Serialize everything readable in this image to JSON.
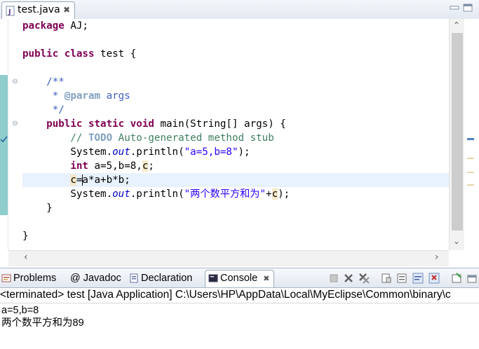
{
  "editor": {
    "tab": {
      "filename": "test.java",
      "close_glyph": "✖"
    },
    "code_lines": [
      "package AJ;",
      "",
      "public class test {",
      "",
      "    /**",
      "     * @param args",
      "     */",
      "    public static void main(String[] args) {",
      "        // TODO Auto-generated method stub",
      "        System.out.println(\"a=5,b=8\");",
      "        int a=5,b=8,c;",
      "        c=a*a+b*b;",
      "        System.out.println(\"两个数平方和为\"+c);",
      "    }",
      "",
      "}"
    ],
    "current_line": 12,
    "caret_after": "c=a*a+b*b;"
  },
  "console_view": {
    "tabs": [
      {
        "label": "Problems",
        "icon": "problems-icon"
      },
      {
        "label": "@ Javadoc",
        "icon": "javadoc-icon"
      },
      {
        "label": "Declaration",
        "icon": "declaration-icon"
      },
      {
        "label": "Console",
        "icon": "console-icon",
        "active": true,
        "close_glyph": "✖"
      }
    ],
    "status": "<terminated> test [Java Application] C:\\Users\\HP\\AppData\\Local\\MyEclipse\\Common\\binary\\c",
    "output": [
      "a=5,b=8",
      "两个数平方和为89"
    ]
  },
  "colors": {
    "keyword": "#7f0055",
    "comment": "#3f7f5f",
    "javadoc": "#3f5fbf",
    "string": "#2a00ff",
    "static_field": "#0000c0",
    "current_line": "#e8f2fe",
    "quick_diff": "#8fcccc"
  }
}
